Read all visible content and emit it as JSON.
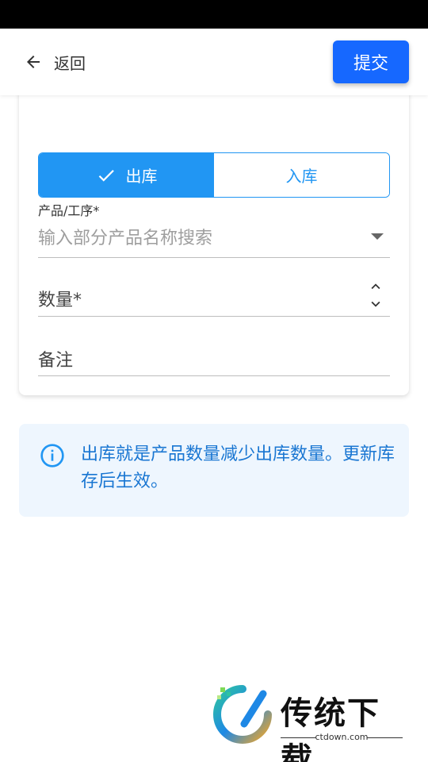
{
  "header": {
    "back_label": "返回",
    "submit_label": "提交"
  },
  "toggle": {
    "options": [
      {
        "label": "出库",
        "selected": true
      },
      {
        "label": "入库",
        "selected": false
      }
    ]
  },
  "form": {
    "product_label": "产品/工序*",
    "product_placeholder": "输入部分产品名称搜索",
    "quantity_label": "数量*",
    "note_label": "备注"
  },
  "info": {
    "text": "出库就是产品数量减少出库数量。更新库存后生效。"
  },
  "watermark": {
    "title": "传统下载",
    "url": "ctdown.com"
  },
  "colors": {
    "primary": "#1668ff",
    "toggle_accent": "#2196f3",
    "info_text": "#1976d2",
    "info_bg": "#eef6fe"
  }
}
